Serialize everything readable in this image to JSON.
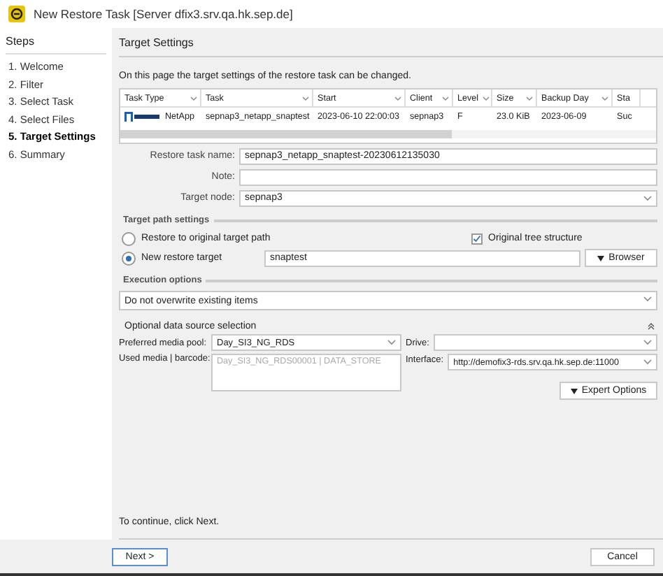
{
  "window": {
    "title": "New Restore Task [Server dfix3.srv.qa.hk.sep.de]"
  },
  "steps": {
    "title": "Steps",
    "items": [
      {
        "label": "1. Welcome",
        "selected": false
      },
      {
        "label": "2. Filter",
        "selected": false
      },
      {
        "label": "3. Select Task",
        "selected": false
      },
      {
        "label": "4. Select Files",
        "selected": false
      },
      {
        "label": "5. Target Settings",
        "selected": true
      },
      {
        "label": "6. Summary",
        "selected": false
      }
    ]
  },
  "page": {
    "title": "Target Settings",
    "description": "On this page the target settings of the restore task can be changed."
  },
  "table": {
    "columns": [
      "Task Type",
      "Task",
      "Start",
      "Client",
      "Level",
      "Size",
      "Backup Day",
      "Sta"
    ],
    "rows": [
      {
        "cells": [
          "NetApp",
          "sepnap3_netapp_snaptest",
          "2023-06-10 22:00:03",
          "sepnap3",
          "F",
          "23.0 KiB",
          "2023-06-09",
          "Suc"
        ]
      }
    ]
  },
  "form": {
    "task_name_label": "Restore task name:",
    "task_name": "sepnap3_netapp_snaptest-20230612135030",
    "note_label": "Note:",
    "target_node_label": "Target node:",
    "target_node": "sepnap3"
  },
  "target_path": {
    "title": "Target path settings",
    "options": [
      {
        "label": "Restore to original target path",
        "selected": false
      },
      {
        "label": "New restore target",
        "selected": true
      }
    ],
    "tree_label": "Original tree structure",
    "tree_checked": true,
    "target_value": "snaptest",
    "browser_button": "Browser"
  },
  "execution": {
    "title": "Execution options",
    "value": "Do not overwrite existing items"
  },
  "data_source": {
    "title": "Optional data source selection",
    "pool_label": "Preferred media pool:",
    "pool": "Day_SI3_NG_RDS",
    "drive_label": "Drive:",
    "media_label": "Used media | barcode:",
    "media": "Day_SI3_NG_RDS00001 | DATA_STORE",
    "interface_label": "Interface:",
    "interface": "http://demofix3-rds.srv.qa.hk.sep.de:11000",
    "expert_button": "Expert Options"
  },
  "hint": "To continue, click Next.",
  "buttons": {
    "next": "Next >",
    "cancel": "Cancel"
  }
}
